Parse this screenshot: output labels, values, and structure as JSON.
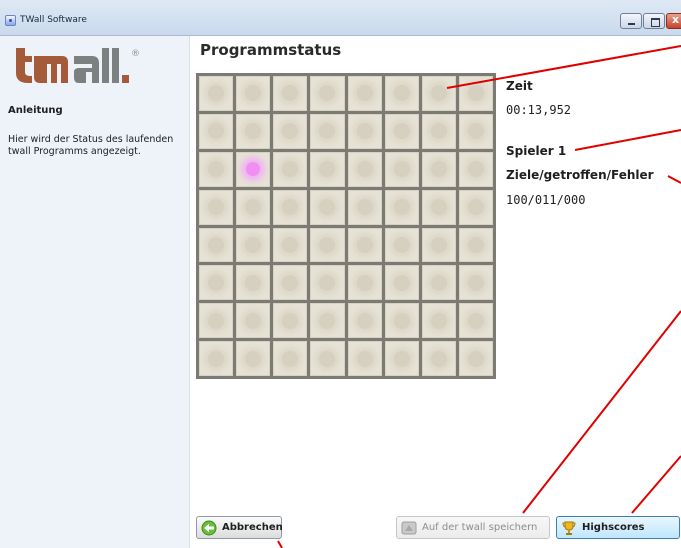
{
  "window": {
    "title": "TWall Software"
  },
  "sidebar": {
    "logo_text": "twall",
    "logo_mark": "®",
    "heading": "Anleitung",
    "description": "Hier wird der Status des laufenden twall Programms angezeigt."
  },
  "main": {
    "title": "Programmstatus",
    "board": {
      "rows": 8,
      "cols": 8,
      "lit_cell": {
        "row": 3,
        "col": 2
      },
      "lit_color": "#f08ef4"
    },
    "stats": {
      "time_label": "Zeit",
      "time_value": "00:13,952",
      "player_label": "Spieler 1",
      "score_label": "Ziele/getroffen/Fehler",
      "score_value": "100/011/000"
    }
  },
  "buttons": {
    "cancel": {
      "label": "Abbrechen",
      "icon": "back-arrow-icon"
    },
    "save": {
      "label": "Auf der twall speichern",
      "icon": "wall-save-icon",
      "enabled": false
    },
    "highscores": {
      "label": "Highscores",
      "icon": "trophy-icon"
    }
  },
  "colors": {
    "annotation_red": "#e00000",
    "logo_brown": "#a55a3a",
    "logo_gray": "#7b8180"
  }
}
